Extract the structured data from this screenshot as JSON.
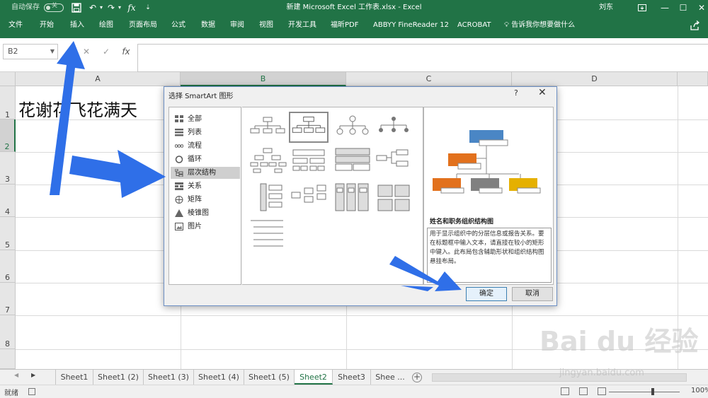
{
  "titlebar": {
    "autosave_label": "自动保存",
    "autosave_state": "关",
    "undo_glyph": "↶",
    "redo_glyph": "↷",
    "save_glyph": "🖫",
    "fx_glyph": "fx",
    "doc_title": "新建 Microsoft Excel 工作表.xlsx  -  Excel",
    "user": "刘东",
    "minimize": "—",
    "restore": "☐",
    "close": "✕"
  },
  "ribbon": {
    "tabs": [
      "文件",
      "开始",
      "插入",
      "绘图",
      "页面布局",
      "公式",
      "数据",
      "审阅",
      "视图",
      "开发工具",
      "福昕PDF",
      "ABBYY FineReader 12",
      "ACROBAT"
    ],
    "tell_me": "告诉我你想要做什么",
    "tell_icon": "lightbulb-icon",
    "share_icon": "share-icon"
  },
  "formula_bar": {
    "name_box": "B2",
    "cancel": "✕",
    "enter": "✓",
    "fx": "fx",
    "value": ""
  },
  "grid": {
    "columns": [
      "A",
      "B",
      "C",
      "D"
    ],
    "rows": [
      "1",
      "2",
      "3",
      "4",
      "5",
      "6",
      "7",
      "8"
    ],
    "selected_col": "B",
    "selected_row": "2",
    "cell_A1": "花谢花飞花满天"
  },
  "sheets": {
    "tabs": [
      "Sheet1",
      "Sheet1 (2)",
      "Sheet1 (3)",
      "Sheet1 (4)",
      "Sheet1 (5)",
      "Sheet2",
      "Sheet3",
      "Shee ..."
    ],
    "active": "Sheet2",
    "add": "+"
  },
  "status": {
    "ready": "就绪",
    "zoom": "100%"
  },
  "dialog": {
    "title": "选择 SmartArt 图形",
    "help": "?",
    "close": "✕",
    "categories": [
      {
        "label": "全部",
        "icon": "grid-icon"
      },
      {
        "label": "列表",
        "icon": "list-icon"
      },
      {
        "label": "流程",
        "icon": "process-icon"
      },
      {
        "label": "循环",
        "icon": "cycle-icon"
      },
      {
        "label": "层次结构",
        "icon": "hierarchy-icon"
      },
      {
        "label": "关系",
        "icon": "relationship-icon"
      },
      {
        "label": "矩阵",
        "icon": "matrix-icon"
      },
      {
        "label": "棱锥图",
        "icon": "pyramid-icon"
      },
      {
        "label": "图片",
        "icon": "picture-icon"
      }
    ],
    "selected_category": "层次结构",
    "preview_title": "姓名和职务组织结构图",
    "preview_description": "用于显示组织中的分层信息或报告关系。要在标题框中输入文本，请直接在较小的矩形中键入。此布局包含辅助形状和组织结构图悬挂布局。",
    "ok": "确定",
    "cancel": "取消",
    "preview_colors": {
      "top": "#4a86c5",
      "left": "#e2711d",
      "mid": "#808080",
      "right": "#e5b000"
    }
  },
  "watermark": {
    "main": "Bai du 经验",
    "sub": "jingyan.baidu.com"
  },
  "annotation_color": "#2f6fe8"
}
